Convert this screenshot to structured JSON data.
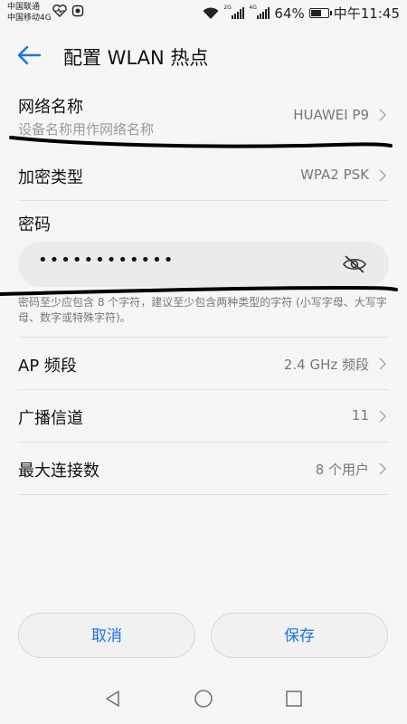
{
  "status_bar": {
    "carrier1": "中国联通",
    "carrier2": "中国移动4G",
    "sim1_tag": "2G",
    "sim2_tag": "4G",
    "battery": "64%",
    "battery_level": 0.64,
    "time": "中午11:45"
  },
  "header": {
    "title": "配置 WLAN 热点"
  },
  "network_name": {
    "label": "网络名称",
    "placeholder": "设备名称用作网络名称",
    "value": "HUAWEI P9"
  },
  "encryption": {
    "label": "加密类型",
    "value": "WPA2 PSK"
  },
  "password": {
    "label": "密码",
    "masked_value": "••••••••••••",
    "hint": "密码至少应包含 8 个字符，建议至少包含两种类型的字符 (小写字母、大写字母、数字或特殊字符)。"
  },
  "ap_band": {
    "label": "AP 频段",
    "value": "2.4 GHz 频段"
  },
  "channel": {
    "label": "广播信道",
    "value": "11"
  },
  "max_connections": {
    "label": "最大连接数",
    "value": "8 个用户"
  },
  "buttons": {
    "cancel": "取消",
    "save": "保存"
  },
  "colors": {
    "accent": "#1a73e8",
    "background": "#f6f6f6"
  },
  "icons": [
    "heart-rate-icon",
    "ring-icon",
    "wifi-icon",
    "signal-icon",
    "battery-icon",
    "back-arrow-icon",
    "chevron-right-icon",
    "eye-off-icon",
    "nav-back-icon",
    "nav-home-icon",
    "nav-recents-icon"
  ]
}
